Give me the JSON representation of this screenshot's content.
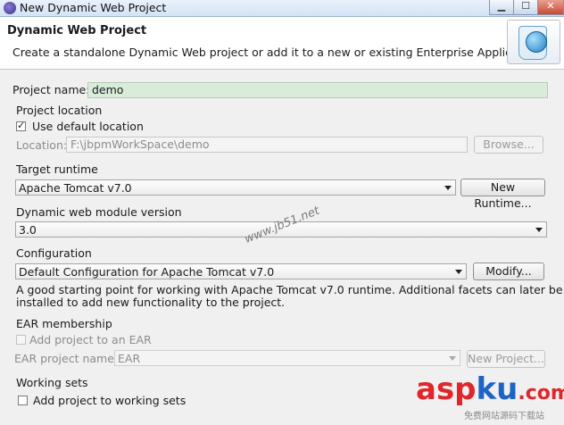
{
  "window": {
    "title": "New Dynamic Web Project"
  },
  "banner": {
    "title": "Dynamic Web Project",
    "description": "Create a standalone Dynamic Web project or add it to a new or existing Enterprise Application."
  },
  "project_name": {
    "label": "Project name:",
    "value": "demo"
  },
  "project_location": {
    "group_label": "Project location",
    "use_default_label": "Use default location",
    "use_default_checked": true,
    "location_label": "Location:",
    "location_value": "F:\\jbpmWorkSpace\\demo",
    "browse_label": "Browse..."
  },
  "target_runtime": {
    "group_label": "Target runtime",
    "selected": "Apache Tomcat v7.0",
    "new_runtime_label": "New Runtime..."
  },
  "module_version": {
    "group_label": "Dynamic web module version",
    "selected": "3.0"
  },
  "configuration": {
    "group_label": "Configuration",
    "selected": "Default Configuration for Apache Tomcat v7.0",
    "modify_label": "Modify...",
    "description_line1": "A good starting point for working with Apache Tomcat v7.0 runtime. Additional facets can later be",
    "description_line2": "installed to add new functionality to the project."
  },
  "ear_membership": {
    "group_label": "EAR membership",
    "add_to_ear_label": "Add project to an EAR",
    "ear_project_name_label": "EAR project name:",
    "ear_project_name_value": "EAR",
    "new_project_label": "New Project..."
  },
  "working_sets": {
    "group_label": "Working sets",
    "add_to_working_sets_label": "Add project to working sets"
  },
  "watermarks": {
    "site": "www.jb51.net",
    "brand_a": "asp",
    "brand_b": "ku",
    "brand_c": ".com",
    "brand_sub": "免费网站源码下载站"
  },
  "colors": {
    "accent_red": "#e0262b",
    "accent_blue": "#1f63c5",
    "field_green": "#d9ecd9"
  }
}
